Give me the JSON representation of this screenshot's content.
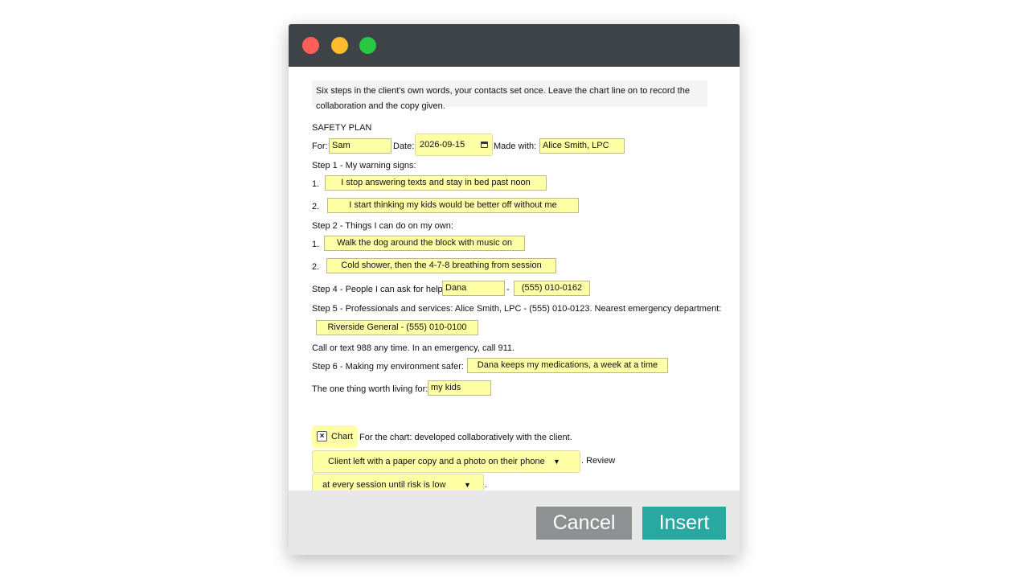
{
  "window": {
    "controls": [
      "close",
      "minimize",
      "zoom"
    ]
  },
  "note": "Six steps in the client's own words, your contacts set once. Leave the chart line on to record the collaboration and the copy given.",
  "plan": {
    "heading": "SAFETY PLAN",
    "for_label": "For:",
    "for_value": "Sam",
    "date_label": "Date:",
    "date_value": "2026-09-15",
    "made_with_label": "Made with:",
    "made_with_value": "Alice Smith, LPC",
    "step1_label": "Step 1 - My warning signs:",
    "step1_items": [
      {
        "num": "1.",
        "value": "I stop answering texts and stay in bed past noon"
      },
      {
        "num": "2.",
        "value": "I start thinking my kids would be better off without me"
      }
    ],
    "step2_label": "Step 2 - Things I can do on my own:",
    "step2_items": [
      {
        "num": "1.",
        "value": "Walk the dog around the block with music on"
      },
      {
        "num": "2.",
        "value": "Cold shower, then the 4-7-8 breathing from session"
      }
    ],
    "step4_label": "Step 4 - People I can ask for help:",
    "step4_name": "Dana",
    "step4_dash": "-",
    "step4_phone": "(555) 010-0162",
    "step5_text": "Step 5 - Professionals and services: Alice Smith, LPC - (555) 010-0123. Nearest emergency department:",
    "step5_value": "Riverside General - (555) 010-0100",
    "crisis_text": "Call or text 988 any time. In an emergency, call 911.",
    "step6_label": "Step 6 - Making my environment safer:",
    "step6_value": "Dana keeps my medications, a week at a time",
    "worth_label": "The one thing worth living for:",
    "worth_value": "my kids"
  },
  "chart": {
    "checkbox_label": "Chart",
    "checked_mark": "×",
    "statement": "For the chart: developed collaboratively with the client.",
    "copy_select": "Client left with a paper copy and a photo on their phone",
    "review_label": ". Review",
    "review_select": "at every session until risk is low",
    "end_period": ".",
    "select_arrow": "▼"
  },
  "footer": {
    "cancel_label": "Cancel",
    "insert_label": "Insert"
  }
}
